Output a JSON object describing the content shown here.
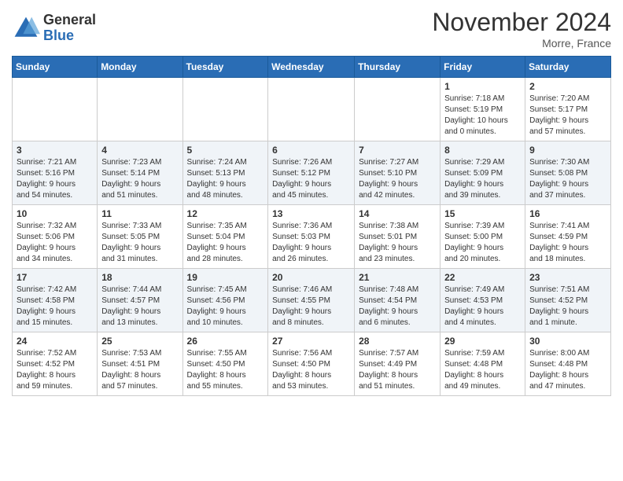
{
  "logo": {
    "general": "General",
    "blue": "Blue"
  },
  "title": "November 2024",
  "location": "Morre, France",
  "days_of_week": [
    "Sunday",
    "Monday",
    "Tuesday",
    "Wednesday",
    "Thursday",
    "Friday",
    "Saturday"
  ],
  "weeks": [
    [
      {
        "day": "",
        "info": ""
      },
      {
        "day": "",
        "info": ""
      },
      {
        "day": "",
        "info": ""
      },
      {
        "day": "",
        "info": ""
      },
      {
        "day": "",
        "info": ""
      },
      {
        "day": "1",
        "info": "Sunrise: 7:18 AM\nSunset: 5:19 PM\nDaylight: 10 hours\nand 0 minutes."
      },
      {
        "day": "2",
        "info": "Sunrise: 7:20 AM\nSunset: 5:17 PM\nDaylight: 9 hours\nand 57 minutes."
      }
    ],
    [
      {
        "day": "3",
        "info": "Sunrise: 7:21 AM\nSunset: 5:16 PM\nDaylight: 9 hours\nand 54 minutes."
      },
      {
        "day": "4",
        "info": "Sunrise: 7:23 AM\nSunset: 5:14 PM\nDaylight: 9 hours\nand 51 minutes."
      },
      {
        "day": "5",
        "info": "Sunrise: 7:24 AM\nSunset: 5:13 PM\nDaylight: 9 hours\nand 48 minutes."
      },
      {
        "day": "6",
        "info": "Sunrise: 7:26 AM\nSunset: 5:12 PM\nDaylight: 9 hours\nand 45 minutes."
      },
      {
        "day": "7",
        "info": "Sunrise: 7:27 AM\nSunset: 5:10 PM\nDaylight: 9 hours\nand 42 minutes."
      },
      {
        "day": "8",
        "info": "Sunrise: 7:29 AM\nSunset: 5:09 PM\nDaylight: 9 hours\nand 39 minutes."
      },
      {
        "day": "9",
        "info": "Sunrise: 7:30 AM\nSunset: 5:08 PM\nDaylight: 9 hours\nand 37 minutes."
      }
    ],
    [
      {
        "day": "10",
        "info": "Sunrise: 7:32 AM\nSunset: 5:06 PM\nDaylight: 9 hours\nand 34 minutes."
      },
      {
        "day": "11",
        "info": "Sunrise: 7:33 AM\nSunset: 5:05 PM\nDaylight: 9 hours\nand 31 minutes."
      },
      {
        "day": "12",
        "info": "Sunrise: 7:35 AM\nSunset: 5:04 PM\nDaylight: 9 hours\nand 28 minutes."
      },
      {
        "day": "13",
        "info": "Sunrise: 7:36 AM\nSunset: 5:03 PM\nDaylight: 9 hours\nand 26 minutes."
      },
      {
        "day": "14",
        "info": "Sunrise: 7:38 AM\nSunset: 5:01 PM\nDaylight: 9 hours\nand 23 minutes."
      },
      {
        "day": "15",
        "info": "Sunrise: 7:39 AM\nSunset: 5:00 PM\nDaylight: 9 hours\nand 20 minutes."
      },
      {
        "day": "16",
        "info": "Sunrise: 7:41 AM\nSunset: 4:59 PM\nDaylight: 9 hours\nand 18 minutes."
      }
    ],
    [
      {
        "day": "17",
        "info": "Sunrise: 7:42 AM\nSunset: 4:58 PM\nDaylight: 9 hours\nand 15 minutes."
      },
      {
        "day": "18",
        "info": "Sunrise: 7:44 AM\nSunset: 4:57 PM\nDaylight: 9 hours\nand 13 minutes."
      },
      {
        "day": "19",
        "info": "Sunrise: 7:45 AM\nSunset: 4:56 PM\nDaylight: 9 hours\nand 10 minutes."
      },
      {
        "day": "20",
        "info": "Sunrise: 7:46 AM\nSunset: 4:55 PM\nDaylight: 9 hours\nand 8 minutes."
      },
      {
        "day": "21",
        "info": "Sunrise: 7:48 AM\nSunset: 4:54 PM\nDaylight: 9 hours\nand 6 minutes."
      },
      {
        "day": "22",
        "info": "Sunrise: 7:49 AM\nSunset: 4:53 PM\nDaylight: 9 hours\nand 4 minutes."
      },
      {
        "day": "23",
        "info": "Sunrise: 7:51 AM\nSunset: 4:52 PM\nDaylight: 9 hours\nand 1 minute."
      }
    ],
    [
      {
        "day": "24",
        "info": "Sunrise: 7:52 AM\nSunset: 4:52 PM\nDaylight: 8 hours\nand 59 minutes."
      },
      {
        "day": "25",
        "info": "Sunrise: 7:53 AM\nSunset: 4:51 PM\nDaylight: 8 hours\nand 57 minutes."
      },
      {
        "day": "26",
        "info": "Sunrise: 7:55 AM\nSunset: 4:50 PM\nDaylight: 8 hours\nand 55 minutes."
      },
      {
        "day": "27",
        "info": "Sunrise: 7:56 AM\nSunset: 4:50 PM\nDaylight: 8 hours\nand 53 minutes."
      },
      {
        "day": "28",
        "info": "Sunrise: 7:57 AM\nSunset: 4:49 PM\nDaylight: 8 hours\nand 51 minutes."
      },
      {
        "day": "29",
        "info": "Sunrise: 7:59 AM\nSunset: 4:48 PM\nDaylight: 8 hours\nand 49 minutes."
      },
      {
        "day": "30",
        "info": "Sunrise: 8:00 AM\nSunset: 4:48 PM\nDaylight: 8 hours\nand 47 minutes."
      }
    ]
  ]
}
